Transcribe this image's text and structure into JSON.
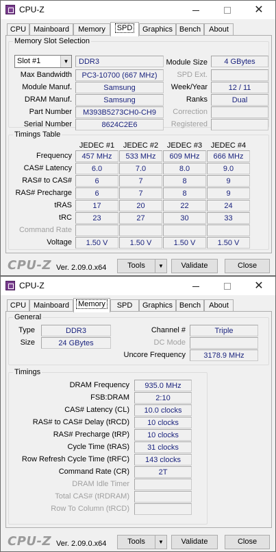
{
  "windows": [
    {
      "title": "CPU-Z",
      "tabs": [
        "CPU",
        "Mainboard",
        "Memory",
        "SPD",
        "Graphics",
        "Bench",
        "About"
      ],
      "active_tab": "SPD",
      "slot_group": {
        "legend": "Memory Slot Selection",
        "slot_value": "Slot #1",
        "type_value": "DDR3",
        "max_bw_label": "Max Bandwidth",
        "max_bw_value": "PC3-10700 (667 MHz)",
        "module_manuf_label": "Module Manuf.",
        "module_manuf_value": "Samsung",
        "dram_manuf_label": "DRAM Manuf.",
        "dram_manuf_value": "Samsung",
        "part_number_label": "Part Number",
        "part_number_value": "M393B5273CH0-CH9",
        "serial_number_label": "Serial Number",
        "serial_number_value": "8624C2E6",
        "module_size_label": "Module Size",
        "module_size_value": "4 GBytes",
        "spd_ext_label": "SPD Ext.",
        "spd_ext_value": "",
        "week_year_label": "Week/Year",
        "week_year_value": "12 / 11",
        "ranks_label": "Ranks",
        "ranks_value": "Dual",
        "correction_label": "Correction",
        "correction_value": "",
        "registered_label": "Registered",
        "registered_value": ""
      },
      "timings_group": {
        "legend": "Timings Table",
        "columns": [
          "JEDEC #1",
          "JEDEC #2",
          "JEDEC #3",
          "JEDEC #4"
        ],
        "rows": [
          {
            "label": "Frequency",
            "values": [
              "457 MHz",
              "533 MHz",
              "609 MHz",
              "666 MHz"
            ],
            "disabled": false
          },
          {
            "label": "CAS# Latency",
            "values": [
              "6.0",
              "7.0",
              "8.0",
              "9.0"
            ],
            "disabled": false
          },
          {
            "label": "RAS# to CAS#",
            "values": [
              "6",
              "7",
              "8",
              "9"
            ],
            "disabled": false
          },
          {
            "label": "RAS# Precharge",
            "values": [
              "6",
              "7",
              "8",
              "9"
            ],
            "disabled": false
          },
          {
            "label": "tRAS",
            "values": [
              "17",
              "20",
              "22",
              "24"
            ],
            "disabled": false
          },
          {
            "label": "tRC",
            "values": [
              "23",
              "27",
              "30",
              "33"
            ],
            "disabled": false
          },
          {
            "label": "Command Rate",
            "values": [
              "",
              "",
              "",
              ""
            ],
            "disabled": true
          },
          {
            "label": "Voltage",
            "values": [
              "1.50 V",
              "1.50 V",
              "1.50 V",
              "1.50 V"
            ],
            "disabled": false
          }
        ]
      },
      "footer": {
        "logo": "CPU-Z",
        "version": "Ver. 2.09.0.x64",
        "tools": "Tools",
        "validate": "Validate",
        "close": "Close"
      }
    },
    {
      "title": "CPU-Z",
      "tabs": [
        "CPU",
        "Mainboard",
        "Memory",
        "SPD",
        "Graphics",
        "Bench",
        "About"
      ],
      "active_tab": "Memory",
      "general_group": {
        "legend": "General",
        "type_label": "Type",
        "type_value": "DDR3",
        "size_label": "Size",
        "size_value": "24 GBytes",
        "channel_label": "Channel #",
        "channel_value": "Triple",
        "dc_mode_label": "DC Mode",
        "dc_mode_value": "",
        "uncore_label": "Uncore Frequency",
        "uncore_value": "3178.9 MHz"
      },
      "timings_group": {
        "legend": "Timings",
        "rows": [
          {
            "label": "DRAM Frequency",
            "value": "935.0 MHz",
            "disabled": false
          },
          {
            "label": "FSB:DRAM",
            "value": "2:10",
            "disabled": false
          },
          {
            "label": "CAS# Latency (CL)",
            "value": "10.0 clocks",
            "disabled": false
          },
          {
            "label": "RAS# to CAS# Delay (tRCD)",
            "value": "10 clocks",
            "disabled": false
          },
          {
            "label": "RAS# Precharge (tRP)",
            "value": "10 clocks",
            "disabled": false
          },
          {
            "label": "Cycle Time (tRAS)",
            "value": "31 clocks",
            "disabled": false
          },
          {
            "label": "Row Refresh Cycle Time (tRFC)",
            "value": "143 clocks",
            "disabled": false
          },
          {
            "label": "Command Rate (CR)",
            "value": "2T",
            "disabled": false
          },
          {
            "label": "DRAM Idle Timer",
            "value": "",
            "disabled": true
          },
          {
            "label": "Total CAS# (tRDRAM)",
            "value": "",
            "disabled": true
          },
          {
            "label": "Row To Column (tRCD)",
            "value": "",
            "disabled": true
          }
        ]
      },
      "footer": {
        "logo": "CPU-Z",
        "version": "Ver. 2.09.0.x64",
        "tools": "Tools",
        "validate": "Validate",
        "close": "Close"
      }
    }
  ],
  "icons": {
    "app": "cpu-z-app-icon",
    "minimize": "minimize-icon",
    "maximize": "maximize-icon",
    "close": "close-icon",
    "dropdown": "chevron-down-icon"
  },
  "colors": {
    "value_text": "#1a237e",
    "logo_text": "#9a9a9a",
    "window_bg": "#f0f0f0"
  }
}
